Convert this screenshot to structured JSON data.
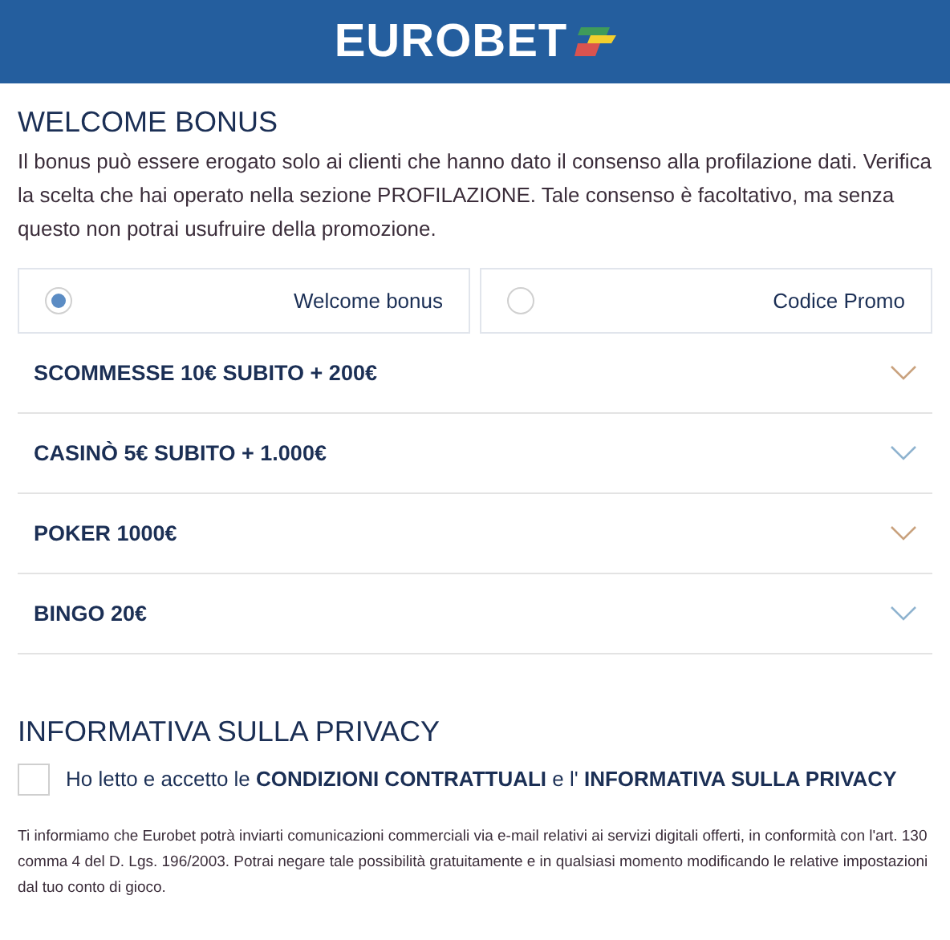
{
  "header": {
    "logo_text": "EUROBET"
  },
  "welcome": {
    "title": "WELCOME BONUS",
    "description": "Il bonus può essere erogato solo ai clienti che hanno dato il consenso alla profilazione dati. Verifica la scelta che hai operato nella sezione PROFILAZIONE. Tale consenso è facoltativo, ma senza questo non potrai usufruire della promozione."
  },
  "options": [
    {
      "label": "Welcome bonus",
      "selected": true
    },
    {
      "label": "Codice Promo",
      "selected": false
    }
  ],
  "bonuses": [
    {
      "label": "SCOMMESSE 10€ SUBITO + 200€",
      "color": "#c9a27e",
      "expanded": false
    },
    {
      "label": "CASINÒ 5€ SUBITO + 1.000€",
      "color": "#8fb3cf",
      "expanded": false
    },
    {
      "label": "POKER 1000€",
      "color": "#c9a27e",
      "expanded": false
    },
    {
      "label": "BINGO 20€",
      "color": "#8fb3cf",
      "expanded": false
    }
  ],
  "privacy": {
    "title": "INFORMATIVA SULLA PRIVACY",
    "checked": false,
    "consent": "Ho letto e accetto le **CONDIZIONI CONTRATTUALI** e l' **INFORMATIVA SULLA PRIVACY**",
    "notice": "Ti informiamo che Eurobet potrà inviarti comunicazioni commerciali via e-mail relativi ai servizi digitali offerti, in conformità con l'art. 130 comma 4 del D. Lgs. 196/2003. Potrai negare tale possibilità gratuitamente e in qualsiasi momento modificando le relative impostazioni dal tuo conto di gioco."
  }
}
